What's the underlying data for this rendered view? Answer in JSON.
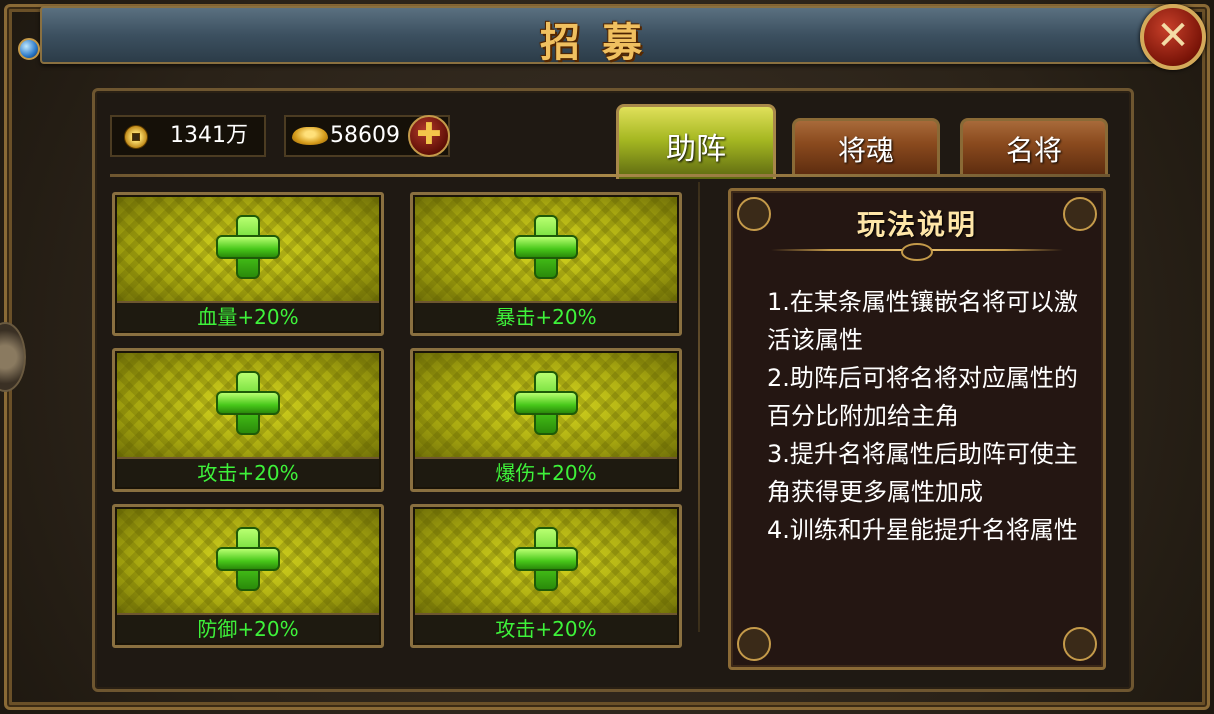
{
  "header": {
    "title": "招募"
  },
  "close_button": {
    "label": "✕"
  },
  "currency": {
    "copper": "1341万",
    "gold": "58609",
    "add_label": "✚"
  },
  "tabs": [
    {
      "label": "助阵",
      "active": true
    },
    {
      "label": "将魂",
      "active": false
    },
    {
      "label": "名将",
      "active": false
    }
  ],
  "slots": [
    {
      "label": "血量+20%"
    },
    {
      "label": "暴击+20%"
    },
    {
      "label": "攻击+20%"
    },
    {
      "label": "爆伤+20%"
    },
    {
      "label": "防御+20%"
    },
    {
      "label": "攻击+20%"
    }
  ],
  "info": {
    "title": "玩法说明",
    "lines": [
      "1.在某条属性镶嵌名将可以激活该属性",
      "2.助阵后可将名将对应属性的百分比附加给主角",
      "3.提升名将属性后助阵可使主角获得更多属性加成",
      "4.训练和升星能提升名将属性"
    ]
  },
  "colors": {
    "slot_label": "#3ef23a",
    "title_gold": "#f0c060",
    "active_tab": "#a6b822"
  }
}
